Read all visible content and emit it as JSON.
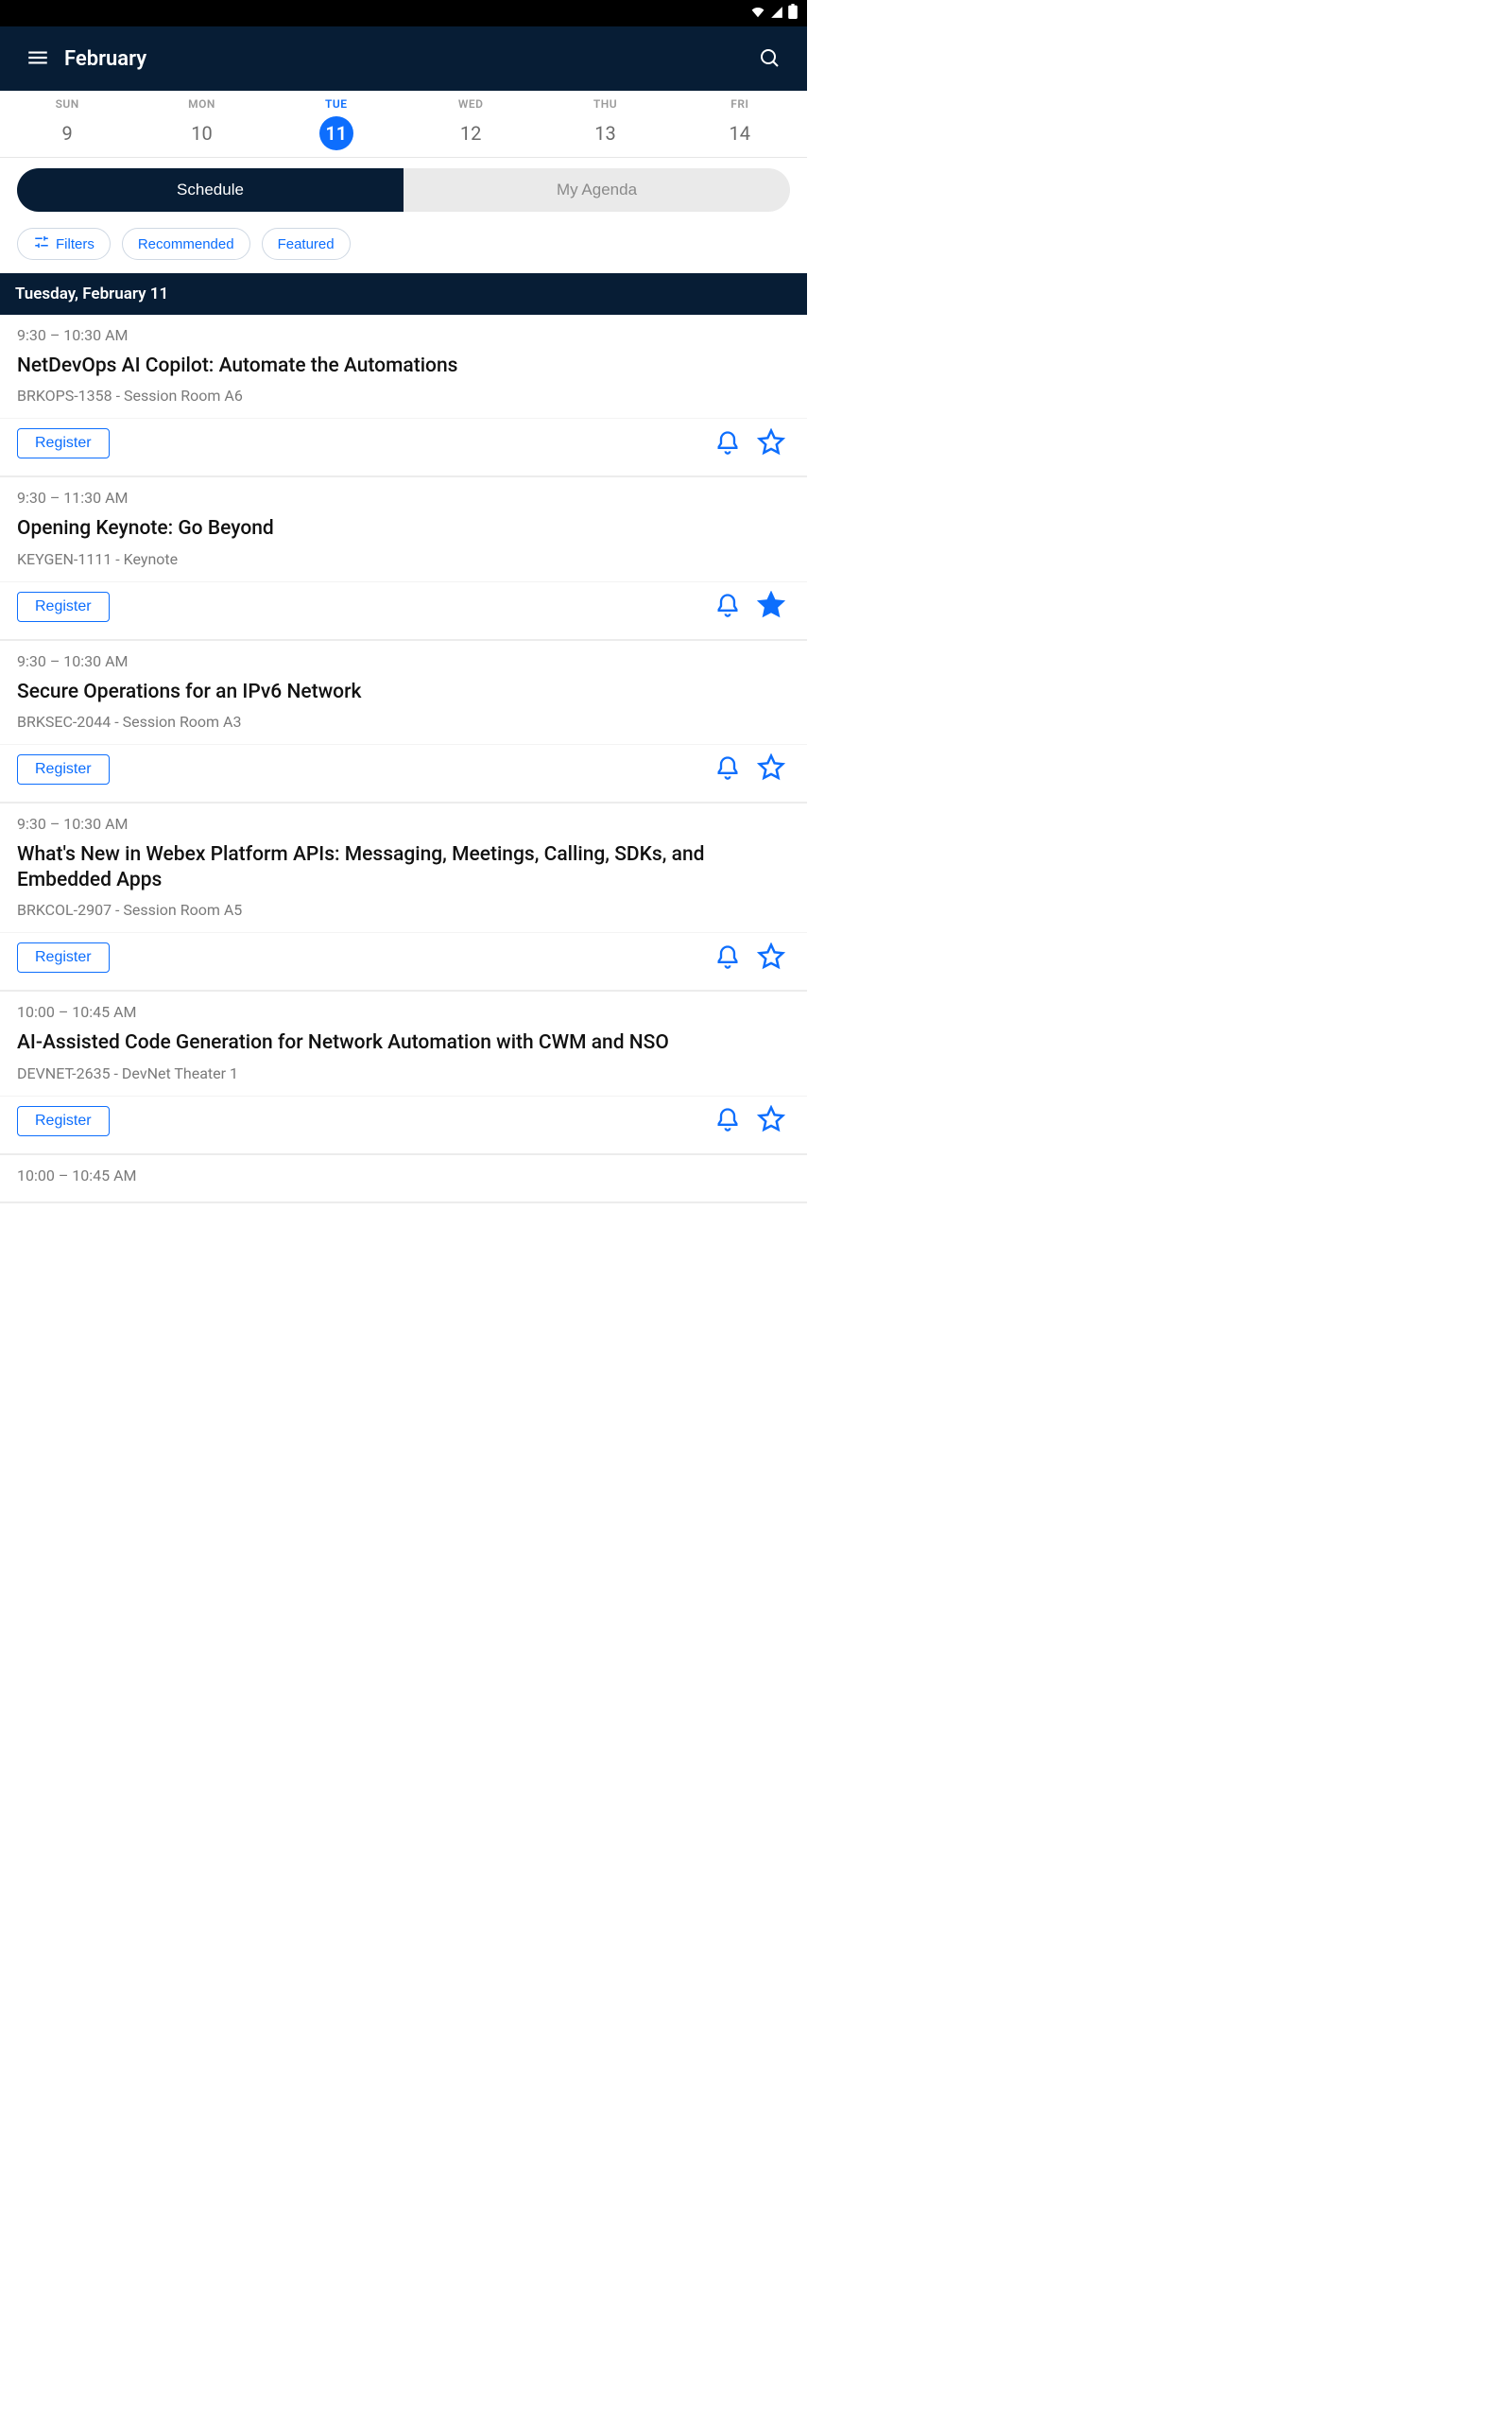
{
  "header": {
    "title": "February"
  },
  "dateStrip": [
    {
      "dow": "SUN",
      "num": "9",
      "active": false
    },
    {
      "dow": "MON",
      "num": "10",
      "active": false
    },
    {
      "dow": "TUE",
      "num": "11",
      "active": true
    },
    {
      "dow": "WED",
      "num": "12",
      "active": false
    },
    {
      "dow": "THU",
      "num": "13",
      "active": false
    },
    {
      "dow": "FRI",
      "num": "14",
      "active": false
    }
  ],
  "tabs": {
    "schedule": "Schedule",
    "myAgenda": "My Agenda",
    "active": "schedule"
  },
  "filters": {
    "filters": "Filters",
    "recommended": "Recommended",
    "featured": "Featured"
  },
  "sectionHeader": "Tuesday, February 11",
  "registerLabel": "Register",
  "sessions": [
    {
      "time": "9:30 – 10:30 AM",
      "title": "NetDevOps AI Copilot: Automate the Automations",
      "meta": "BRKOPS-1358 - Session Room A6",
      "starred": false
    },
    {
      "time": "9:30 – 11:30 AM",
      "title": "Opening Keynote: Go Beyond",
      "meta": "KEYGEN-1111 - Keynote",
      "starred": true
    },
    {
      "time": "9:30 – 10:30 AM",
      "title": "Secure Operations for an IPv6 Network",
      "meta": "BRKSEC-2044 - Session Room A3",
      "starred": false
    },
    {
      "time": "9:30 – 10:30 AM",
      "title": "What's New in Webex Platform APIs: Messaging, Meetings, Calling, SDKs, and Embedded Apps",
      "meta": "BRKCOL-2907 - Session Room A5",
      "starred": false
    },
    {
      "time": "10:00 – 10:45 AM",
      "title": "AI-Assisted Code Generation for Network Automation with CWM and NSO",
      "meta": "DEVNET-2635 - DevNet Theater 1",
      "starred": false
    },
    {
      "time": "10:00 – 10:45 AM",
      "title": "",
      "meta": "",
      "starred": false,
      "partial": true
    }
  ]
}
